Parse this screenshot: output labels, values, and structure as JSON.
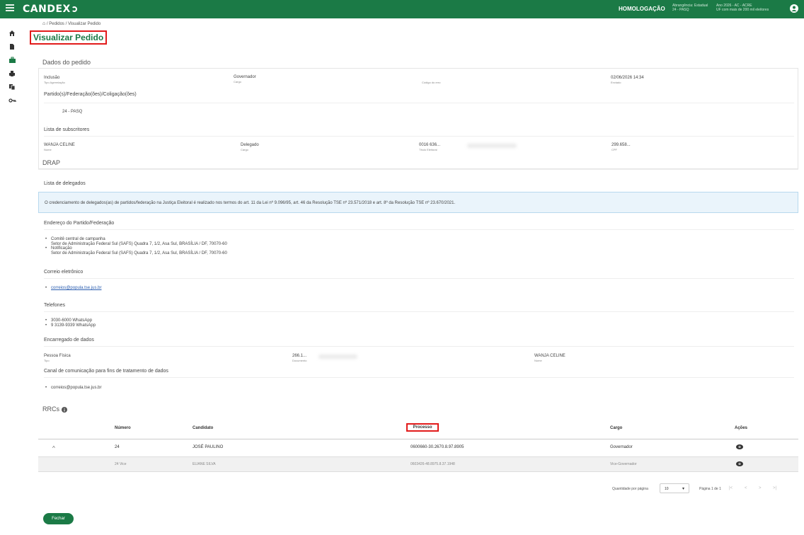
{
  "app": {
    "logo_text": "CANDEX",
    "environment": "HOMOLOGAÇÃO",
    "info_a": [
      "Abrangência: Estadual",
      "24 - PASQ"
    ],
    "info_b": [
      "Ano 2026 - AC - ACRE",
      "UF com mais de 200 mil eleitores"
    ]
  },
  "breadcrumb": {
    "pedidos": "Pedidos",
    "sep": "/",
    "current": "Visualizar Pedido"
  },
  "page_title": "Visualizar Pedido",
  "dados": {
    "heading": "Dados do pedido",
    "pedido_value": "Inclusão",
    "pedido_label": "Tipo Agremiação",
    "cargo_value": "Governador",
    "cargo_label": "Cargo",
    "codigo_label": "Código do erro",
    "data_value": "02/06/2026 14:34",
    "data_label": "Enviado"
  },
  "partidos": {
    "heading": "Partido(s)/Federação(ões)/Coligação(ões)",
    "item": "24 - PASQ"
  },
  "subscritores": {
    "heading": "Lista de subscritores",
    "nome_value": "WANJA CELINE",
    "nome_label": "Nome",
    "cargo_value": "Delegado",
    "cargo_label": "Cargo",
    "titulo_value": "0016 636...",
    "titulo_label": "Título Eleitoral",
    "cpf_value": "299.658...",
    "cpf_label": "CPF"
  },
  "drap": {
    "heading": "DRAP"
  },
  "delegados": {
    "heading": "Lista de delegados",
    "alert": "O credenciamento de delegados(as) de partidos/federação na Justiça Eleitoral é realizado nos termos do art. 11 da Lei nº 9.096/95, art. 46 da Resolução TSE nº 23.571/2018 e art. 8º da Resolução TSE nº 23.670/2021."
  },
  "endereco": {
    "heading": "Endereço do Partido/Federação",
    "items": [
      {
        "title": "Comitê central de campanha",
        "address": "Setor de Administração Federal Sul (SAFS) Quadra 7, 1/2, Asa Sul, BRASÍLIA / DF, 70070-60"
      },
      {
        "title": "Notificação",
        "address": "Setor de Administração Federal Sul (SAFS) Quadra 7, 1/2, Asa Sul, BRASÍLIA / DF, 70070-60"
      }
    ]
  },
  "correio": {
    "heading": "Correio eletrônico",
    "email": "correios@popula.tse.jus.br"
  },
  "telefones": {
    "heading": "Telefones",
    "items": [
      "3030-6000 WhatsApp",
      "9 3139-9339 WhatsApp"
    ]
  },
  "encarregado": {
    "heading": "Encarregado de dados",
    "tipo_value": "Pessoa Física",
    "tipo_label": "Tipo",
    "doc_value": "266.1...",
    "doc_label": "Documento",
    "nome_value": "WANJA CELINE",
    "nome_label": "Nome"
  },
  "canal": {
    "heading": "Canal de comunicação para fins de tratamento de dados",
    "email": "correios@popula.tse.jus.br"
  },
  "rrcs": {
    "heading": "RRCs",
    "headers": {
      "numero": "Número",
      "candidato": "Candidato",
      "processo": "Processo",
      "cargo": "Cargo",
      "acoes": "Ações"
    },
    "rows": [
      {
        "toggle": "^",
        "numero": "24",
        "candidato": "JOSÉ PAULINO",
        "processo": "0600660-30.2670.8.97.8905",
        "cargo": "Governador"
      },
      {
        "toggle": "",
        "numero": "24 Vice",
        "candidato": "ELIANE SILVA",
        "processo": "0603426-48.8975.8.37.1948",
        "cargo": "Vice-Governador"
      }
    ]
  },
  "pager": {
    "label": "Quantidade por página",
    "per_page": "10",
    "page_text": "Página 1 de 1",
    "nav": [
      "|<",
      "<",
      ">",
      ">|"
    ]
  },
  "footer": {
    "close_label": "Fechar"
  },
  "colors": {
    "brand": "#1b7a46",
    "highlight": "#e21b1b",
    "alert_bg": "#eaf4fb"
  }
}
